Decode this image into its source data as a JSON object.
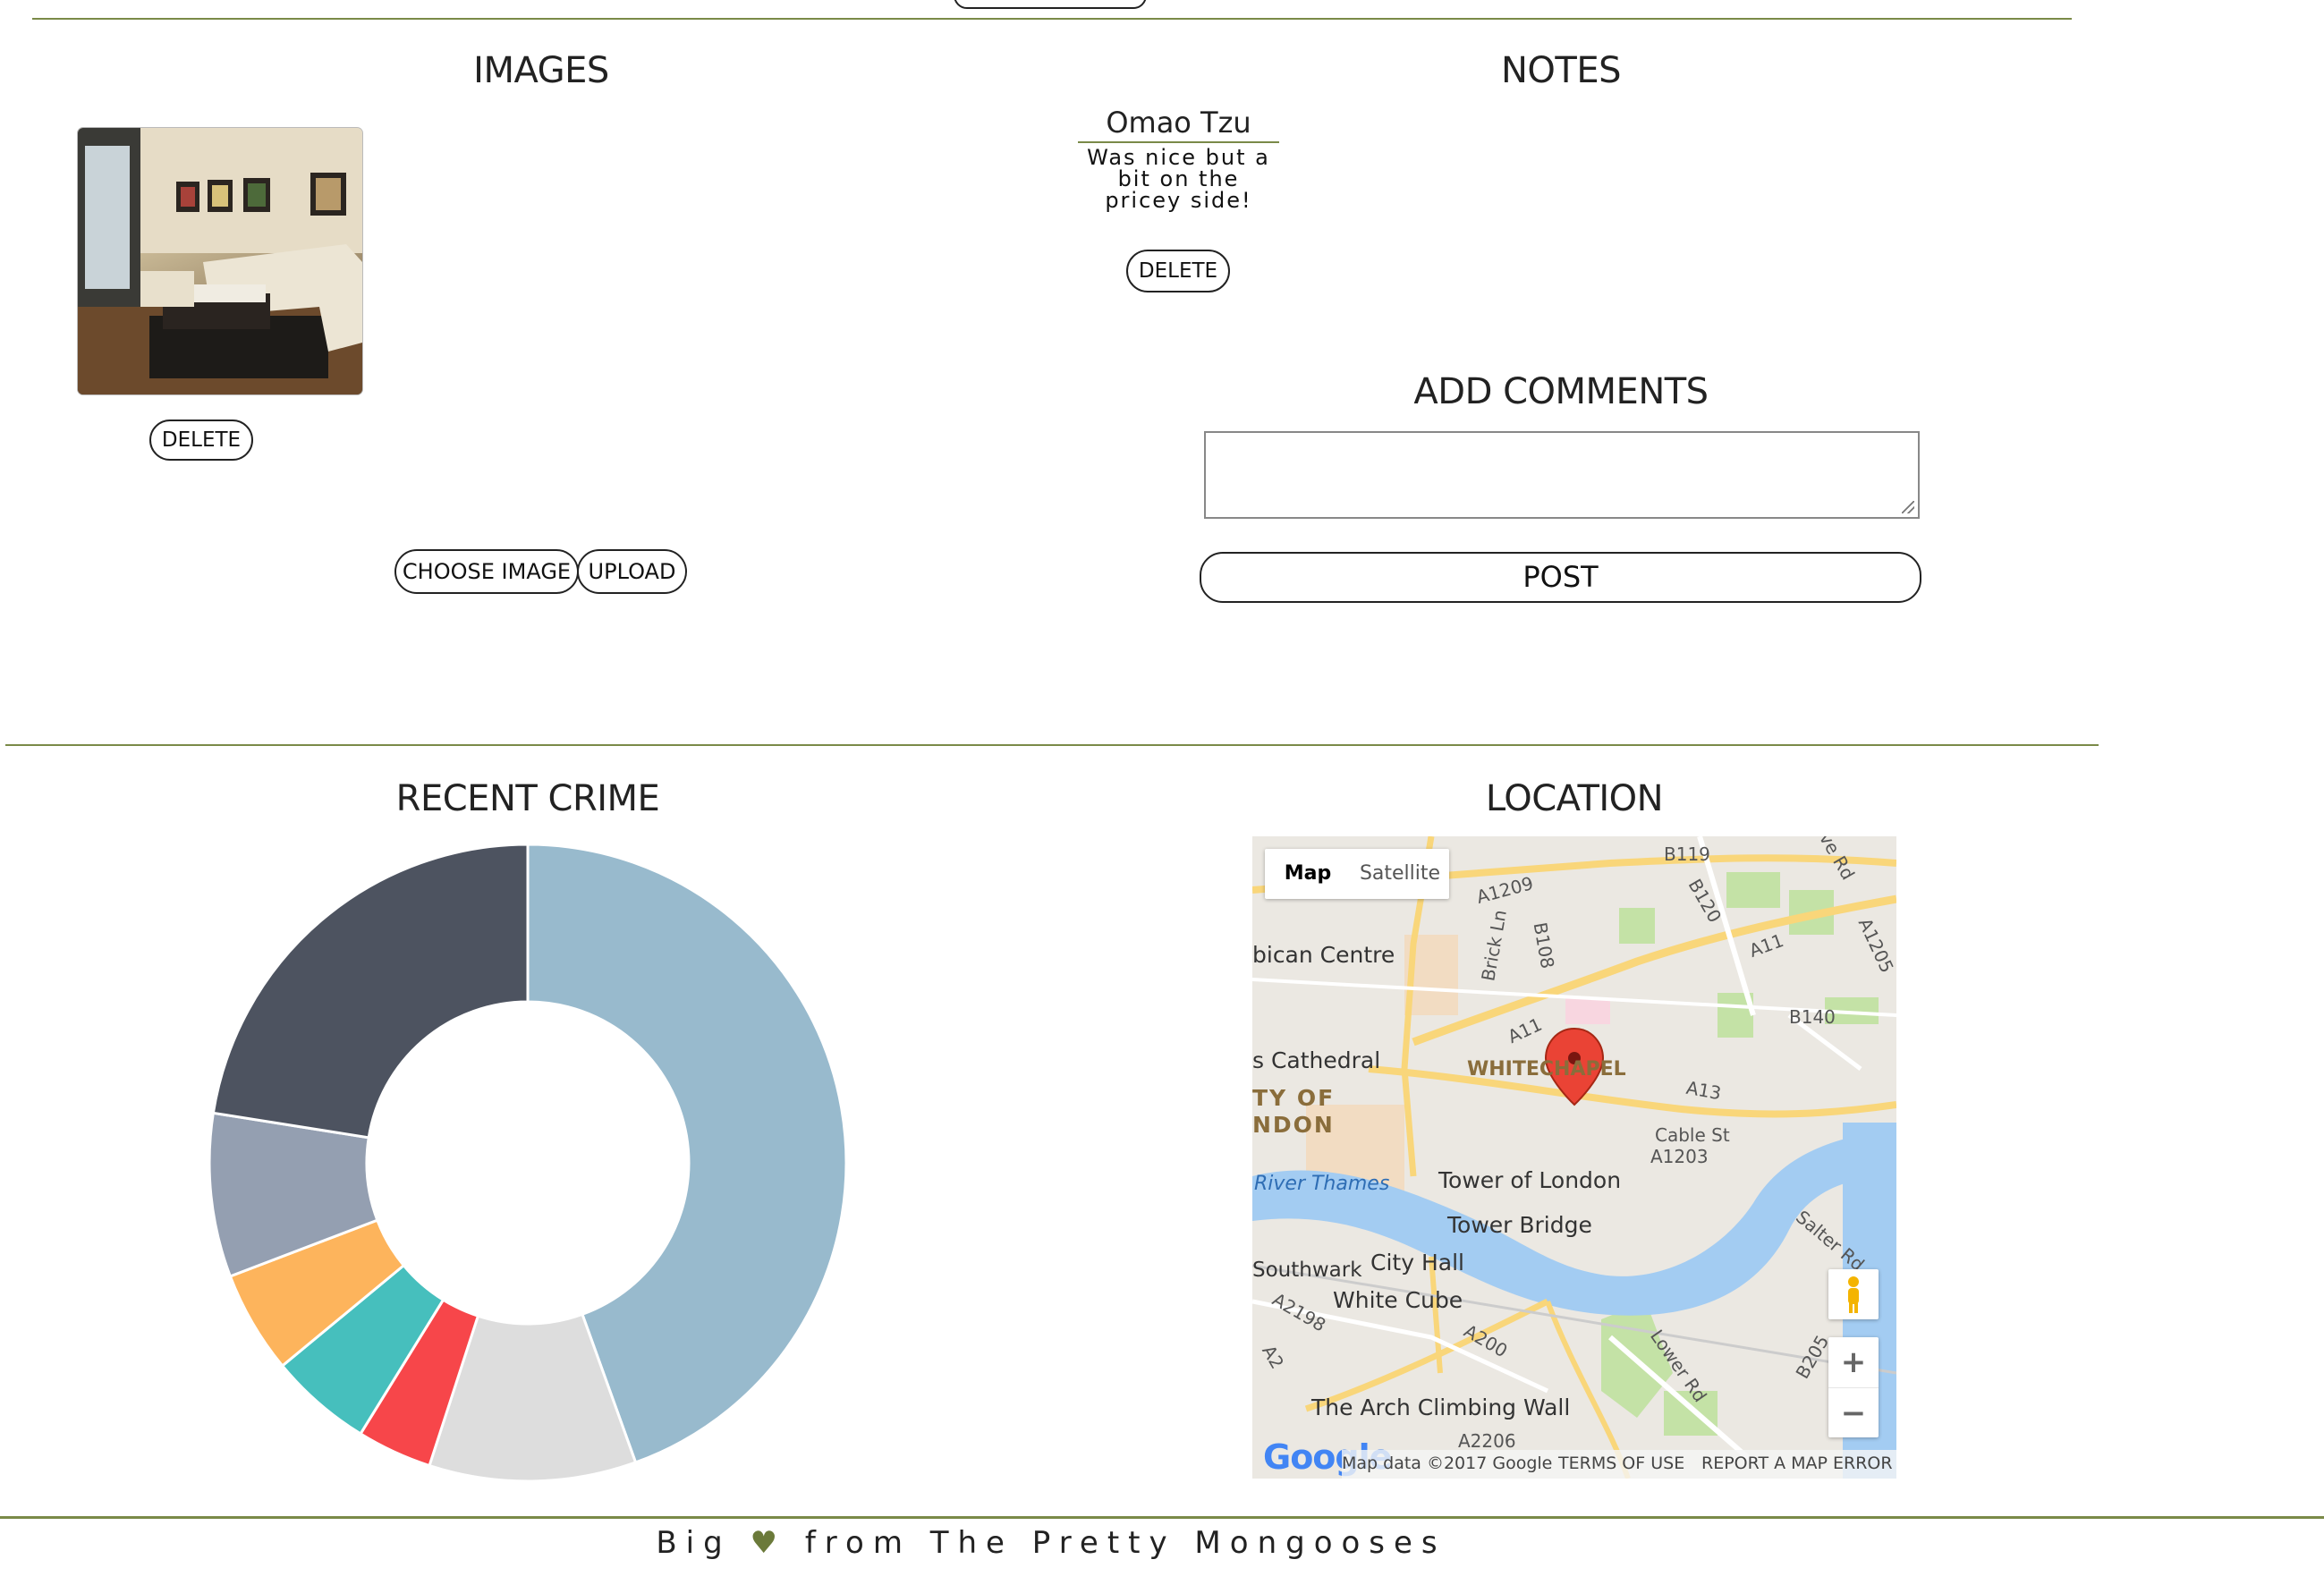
{
  "images": {
    "heading": "IMAGES",
    "thumbnail_alt": "living room",
    "delete_label": "DELETE",
    "choose_label": "CHOOSE IMAGE",
    "upload_label": "UPLOAD"
  },
  "notes": {
    "heading": "NOTES",
    "items": [
      {
        "author": "Omao Tzu",
        "text": "Was nice but a bit on the pricey side!",
        "delete_label": "DELETE"
      }
    ]
  },
  "comments": {
    "heading": "ADD COMMENTS",
    "value": "",
    "post_label": "POST"
  },
  "crime": {
    "heading": "RECENT CRIME"
  },
  "chart_data": {
    "type": "pie",
    "donut": true,
    "legend": "none",
    "slices": [
      {
        "value": 44.5,
        "color": "#98bacd"
      },
      {
        "value": 10.5,
        "color": "#dddddd"
      },
      {
        "value": 3.8,
        "color": "#f7464a"
      },
      {
        "value": 5.2,
        "color": "#46bfbd"
      },
      {
        "value": 5.2,
        "color": "#fdb45c"
      },
      {
        "value": 8.3,
        "color": "#949fb1"
      },
      {
        "value": 22.5,
        "color": "#4d5360"
      }
    ]
  },
  "location": {
    "heading": "LOCATION",
    "map_tab": "Map",
    "satellite_tab": "Satellite",
    "places": {
      "barbican": "bican Centre",
      "cathedral": "s Cathedral",
      "whitechapel": "WHITECHAPEL",
      "city1": "TY OF",
      "city2": "NDON",
      "thames": "River Thames",
      "tower": "Tower of London",
      "bridge": "Tower Bridge",
      "cityhall": "City Hall",
      "southwark": "Southwark",
      "whitecube": "White Cube",
      "arch": "The Arch Climbing Wall",
      "cable": "Cable St",
      "brick": "Brick Ln",
      "salter": "Salter Rd",
      "lower": "Lower Rd"
    },
    "roads": [
      "B119",
      "A1209",
      "B120",
      "A11",
      "A1205",
      "B108",
      "B140",
      "A11",
      "A13",
      "A1203",
      "A2198",
      "A2",
      "A200",
      "B205",
      "A2206",
      "ve Rd"
    ],
    "google": "Google",
    "attribution": "Map data ©2017 Google",
    "terms": "TERMS OF USE",
    "report": "REPORT A MAP ERROR",
    "zoom_in": "+",
    "zoom_out": "−"
  },
  "footer": {
    "text_left": "Big",
    "heart": "♥",
    "text_right": "from The Pretty Mongooses",
    "heart_color": "#6b7a3a"
  }
}
